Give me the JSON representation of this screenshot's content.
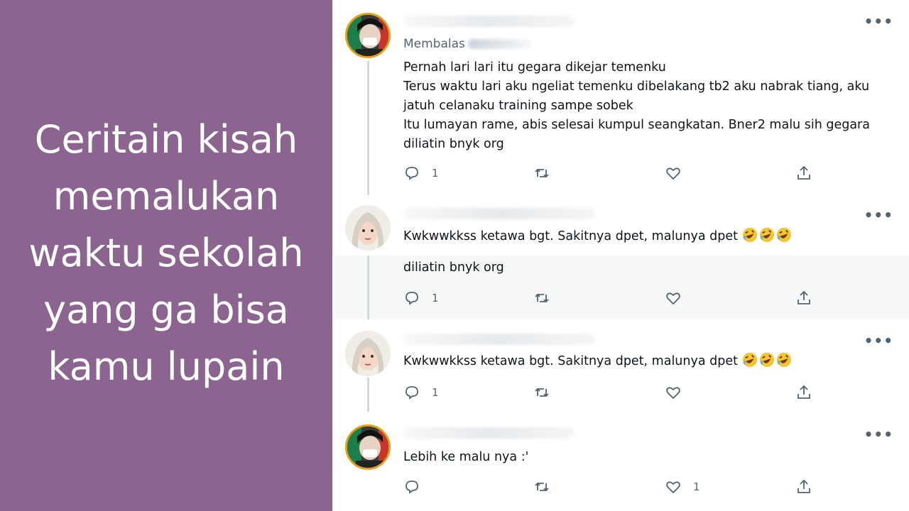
{
  "caption": {
    "lines": [
      "Ceritain kisah",
      "memalukan",
      "waktu sekolah",
      "yang ga bisa",
      "kamu lupain"
    ]
  },
  "tweets": [
    {
      "replying_label": "Membalas",
      "lines": [
        "Pernah lari lari itu gegara dikejar temenku",
        "Terus waktu lari aku ngeliat temenku dibelakang tb2 aku nabrak tiang, aku",
        "jatuh celanaku training sampe sobek",
        "Itu lumayan rame, abis selesai kumpul seangkatan. Bner2 malu sih gegara",
        "diliatin bnyk org"
      ],
      "reply_count": "1",
      "like_count": ""
    },
    {
      "text": "Kwkwwkkss ketawa bgt. Sakitnya dpet, malunya dpet",
      "emoji": "rolling-on-floor-laughing x3"
    },
    {
      "lines": [
        "diliatin bnyk org"
      ],
      "reply_count": "1",
      "like_count": ""
    },
    {
      "text": "Kwkwwkkss ketawa bgt. Sakitnya dpet, malunya dpet",
      "emoji": "rolling-on-floor-laughing x3",
      "reply_count": "1",
      "like_count": ""
    },
    {
      "text": "Lebih ke malu nya :'",
      "reply_count": "",
      "like_count": "1"
    }
  ],
  "colors": {
    "left_panel": "#8b6590",
    "text": "#0f1419",
    "muted": "#536471",
    "thread_line": "#cfd9de"
  },
  "icons": [
    "reply-icon",
    "retweet-icon",
    "like-icon",
    "share-icon",
    "more-icon"
  ]
}
